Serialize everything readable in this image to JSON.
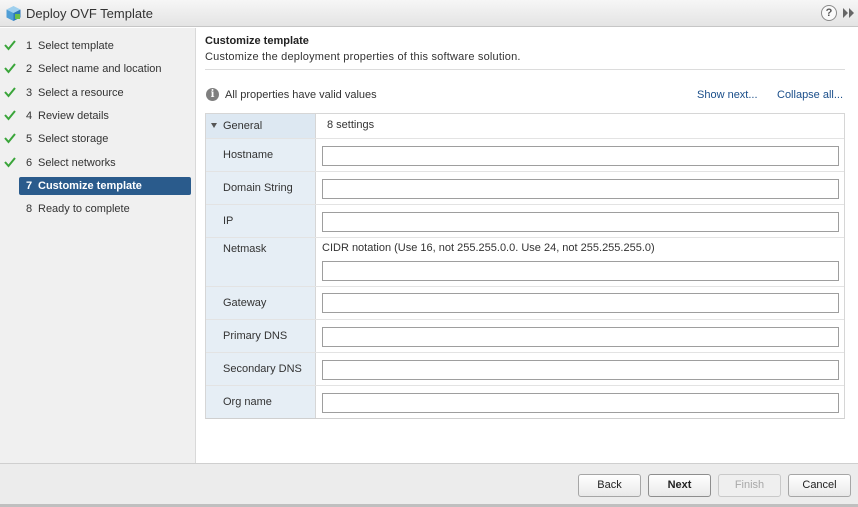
{
  "window": {
    "title": "Deploy OVF Template",
    "icons": {
      "app": "ovf-package-icon",
      "help": "help-icon",
      "expand": "double-chevron-right-icon"
    },
    "help_glyph": "?"
  },
  "steps": [
    {
      "num": "1",
      "label": "Select template",
      "done": true
    },
    {
      "num": "2",
      "label": "Select name and location",
      "done": true
    },
    {
      "num": "3",
      "label": "Select a resource",
      "done": true
    },
    {
      "num": "4",
      "label": "Review details",
      "done": true
    },
    {
      "num": "5",
      "label": "Select storage",
      "done": true
    },
    {
      "num": "6",
      "label": "Select networks",
      "done": true
    },
    {
      "num": "7",
      "label": "Customize template",
      "active": true
    },
    {
      "num": "8",
      "label": "Ready to complete"
    }
  ],
  "main": {
    "title": "Customize template",
    "subtitle": "Customize the deployment properties of this software solution.",
    "status_text": "All properties have valid values",
    "show_next_link": "Show next...",
    "collapse_all_link": "Collapse all...",
    "group": {
      "label": "General",
      "count": "8 settings"
    },
    "fields": [
      {
        "label": "Hostname",
        "value": ""
      },
      {
        "label": "Domain String",
        "value": ""
      },
      {
        "label": "IP",
        "value": ""
      },
      {
        "label": "Netmask",
        "hint": "CIDR notation (Use 16, not 255.255.0.0. Use 24, not 255.255.255.0)",
        "value": ""
      },
      {
        "label": "Gateway",
        "value": ""
      },
      {
        "label": "Primary DNS",
        "value": ""
      },
      {
        "label": "Secondary DNS",
        "value": ""
      },
      {
        "label": "Org name",
        "value": ""
      }
    ]
  },
  "footer": {
    "back": "Back",
    "next": "Next",
    "finish": "Finish",
    "cancel": "Cancel"
  },
  "colors": {
    "active_step": "#2a5b8c",
    "check": "#3aa53a",
    "link": "#1a4e8a",
    "label_cell": "#e6eef5"
  }
}
